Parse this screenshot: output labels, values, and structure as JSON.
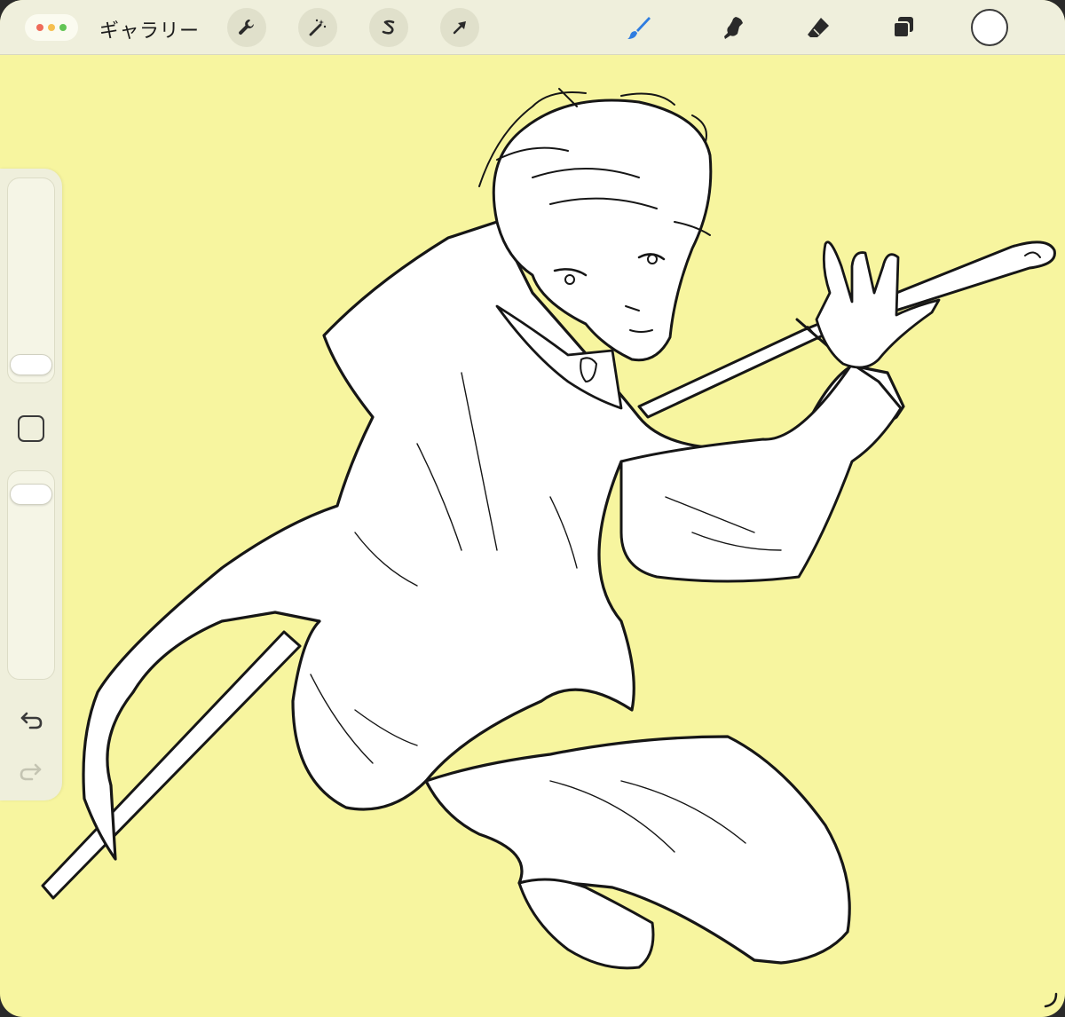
{
  "window": {
    "dot_colors": [
      "#ef6b5a",
      "#f5bf4f",
      "#62c554"
    ]
  },
  "toolbar": {
    "gallery_label": "ギャラリー",
    "left_tools": [
      {
        "icon": "wrench-icon",
        "name": "actions"
      },
      {
        "icon": "magic-wand-icon",
        "name": "adjustments"
      },
      {
        "icon": "selection-s-icon",
        "name": "selection"
      },
      {
        "icon": "transform-arrow-icon",
        "name": "transform"
      }
    ],
    "right_tools": [
      {
        "icon": "brush-icon",
        "name": "paint",
        "active": true
      },
      {
        "icon": "smudge-icon",
        "name": "smudge",
        "active": false
      },
      {
        "icon": "eraser-icon",
        "name": "erase",
        "active": false
      },
      {
        "icon": "layers-icon",
        "name": "layers",
        "active": false
      }
    ],
    "current_color": "#ffffff",
    "active_color": "#2f7de0"
  },
  "sidebar": {
    "brush_size_level": 0.05,
    "opacity_level": 0.95,
    "undo_icon": "undo-arrow-icon",
    "redo_icon": "redo-arrow-icon",
    "redo_enabled": false
  },
  "canvas": {
    "background_color": "#f7f59f",
    "artwork": "sketch-swordsman"
  }
}
